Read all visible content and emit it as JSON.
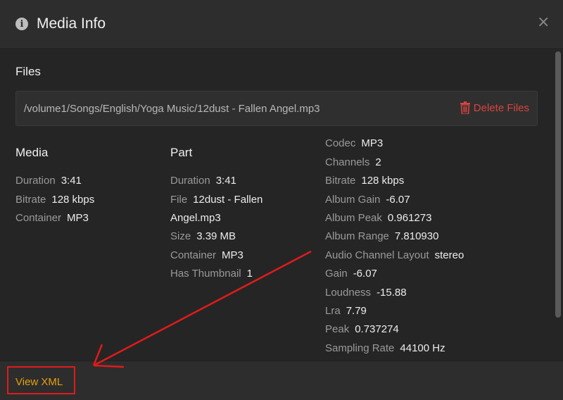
{
  "header": {
    "title": "Media Info",
    "info_icon": "info-icon",
    "close_glyph": "×"
  },
  "files": {
    "heading": "Files",
    "path": "/volume1/Songs/English/Yoga Music/12dust - Fallen Angel.mp3",
    "delete_label": "Delete Files"
  },
  "media": {
    "heading": "Media",
    "rows": [
      {
        "k": "Duration",
        "v": "3:41"
      },
      {
        "k": "Bitrate",
        "v": "128 kbps"
      },
      {
        "k": "Container",
        "v": "MP3"
      }
    ]
  },
  "part": {
    "heading": "Part",
    "duration": {
      "k": "Duration",
      "v": "3:41"
    },
    "file": {
      "k": "File",
      "v": "12dust - Fallen",
      "v2": "Angel.mp3"
    },
    "size": {
      "k": "Size",
      "v": "3.39 MB"
    },
    "container": {
      "k": "Container",
      "v": "MP3"
    },
    "thumb": {
      "k": "Has Thumbnail",
      "v": "1"
    }
  },
  "stream": {
    "rows": [
      {
        "k": "Codec",
        "v": "MP3"
      },
      {
        "k": "Channels",
        "v": "2"
      },
      {
        "k": "Bitrate",
        "v": "128 kbps"
      },
      {
        "k": "Album Gain",
        "v": "-6.07"
      },
      {
        "k": "Album Peak",
        "v": "0.961273"
      },
      {
        "k": "Album Range",
        "v": "7.810930"
      },
      {
        "k": "Audio Channel Layout",
        "v": "stereo"
      },
      {
        "k": "Gain",
        "v": "-6.07"
      },
      {
        "k": "Loudness",
        "v": "-15.88"
      },
      {
        "k": "Lra",
        "v": "7.79"
      },
      {
        "k": "Peak",
        "v": "0.737274"
      },
      {
        "k": "Sampling Rate",
        "v": "44100 Hz"
      }
    ]
  },
  "footer": {
    "view_xml_label": "View XML"
  },
  "colors": {
    "accent": "#e5a00d",
    "danger": "#d7443f",
    "annotation": "#e01b1b"
  }
}
